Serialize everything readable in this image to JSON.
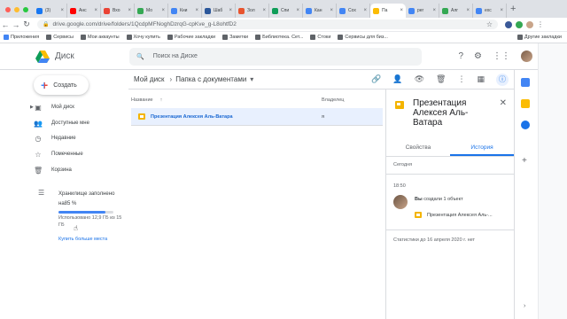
{
  "browser": {
    "tabs": [
      {
        "label": "(3)",
        "color": "#1877f2"
      },
      {
        "label": "Анс",
        "color": "#ff0000"
      },
      {
        "label": "Вхо",
        "color": "#ea4335"
      },
      {
        "label": "Мо",
        "color": "#34a853"
      },
      {
        "label": "Кни",
        "color": "#4285f4"
      },
      {
        "label": "Шаб",
        "color": "#2b579a"
      },
      {
        "label": "Зол",
        "color": "#e8542e"
      },
      {
        "label": "Спи",
        "color": "#0f9d58"
      },
      {
        "label": "Кан",
        "color": "#4285f4"
      },
      {
        "label": "Сох",
        "color": "#4285f4"
      },
      {
        "label": "Па",
        "color": "#fbbc04",
        "active": true
      },
      {
        "label": "per",
        "color": "#4285f4"
      },
      {
        "label": "Алг",
        "color": "#34a853"
      },
      {
        "label": "exc",
        "color": "#4285f4"
      }
    ],
    "url": "drive.google.com/drive/folders/1QcdpMFNoghDzrqG-cpKve_g-L8ohtfD2",
    "bookmarks": [
      "Приложения",
      "Сервисы",
      "Мои аккаунты",
      "Хочу купить",
      "Рабочие закладки",
      "Заметки",
      "Библиотека. Сет...",
      "Стоки",
      "Сервисы для биз..."
    ],
    "bookmarks_other": "Другие закладки"
  },
  "header": {
    "app_name": "Диск",
    "search_placeholder": "Поиск на Диске"
  },
  "sidebar": {
    "create_label": "Создать",
    "items": [
      {
        "label": "Мой диск",
        "icon": "my-drive-icon"
      },
      {
        "label": "Доступные мне",
        "icon": "shared-icon"
      },
      {
        "label": "Недавние",
        "icon": "clock-icon"
      },
      {
        "label": "Помеченные",
        "icon": "star-icon"
      },
      {
        "label": "Корзина",
        "icon": "trash-icon"
      }
    ],
    "storage_title": "Хранилище заполнено на85 %",
    "storage_used": "Использовано 12,9 ГБ из 15 ГБ",
    "storage_fraction": 0.85,
    "buy_more": "Купить больше места"
  },
  "main": {
    "breadcrumb_root": "Мой диск",
    "breadcrumb_current": "Папка с документами",
    "col_name": "Название",
    "col_owner": "Владелец",
    "files": [
      {
        "name": "Презентация Алексея Аль-Ватара",
        "owner": "я"
      }
    ]
  },
  "details": {
    "title": "Презентация Алексея Аль-Ватара",
    "tab_properties": "Свойства",
    "tab_history": "История",
    "today": "Сегодня",
    "time": "18:50",
    "actor": "Вы",
    "action": "создали 1 объект",
    "file": "Презентация Алексея Аль-...",
    "stats": "Статистики до 16 апреля 2020 г. нет"
  },
  "colors": {
    "accent": "#1a73e8",
    "selected_row": "#e8f0fe",
    "slides_yellow": "#f4b400"
  }
}
